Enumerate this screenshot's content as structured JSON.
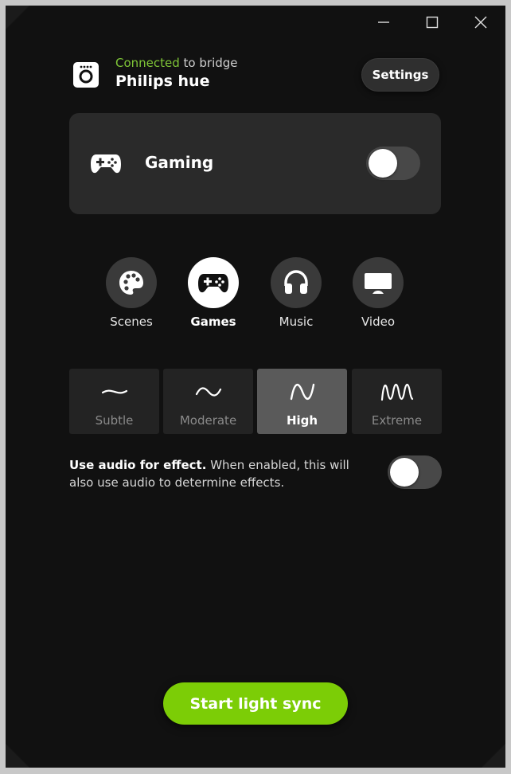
{
  "header": {
    "status_ok": "Connected",
    "status_rest": " to bridge",
    "bridge_name": "Philips hue",
    "settings_label": "Settings"
  },
  "mode_card": {
    "label": "Gaming",
    "toggle_on": false
  },
  "categories": [
    {
      "label": "Scenes",
      "icon": "palette-icon",
      "active": false
    },
    {
      "label": "Games",
      "icon": "gamepad-icon",
      "active": true
    },
    {
      "label": "Music",
      "icon": "headphones-icon",
      "active": false
    },
    {
      "label": "Video",
      "icon": "monitor-icon",
      "active": false
    }
  ],
  "intensity": [
    {
      "label": "Subtle",
      "active": false
    },
    {
      "label": "Moderate",
      "active": false
    },
    {
      "label": "High",
      "active": true
    },
    {
      "label": "Extreme",
      "active": false
    }
  ],
  "audio": {
    "title": "Use audio for effect.",
    "description": " When enabled, this will also use audio to determine effects.",
    "toggle_on": false
  },
  "start_label": "Start light sync",
  "colors": {
    "accent_green": "#7ccd06",
    "connected_green": "#7fc637",
    "background": "#111111"
  }
}
